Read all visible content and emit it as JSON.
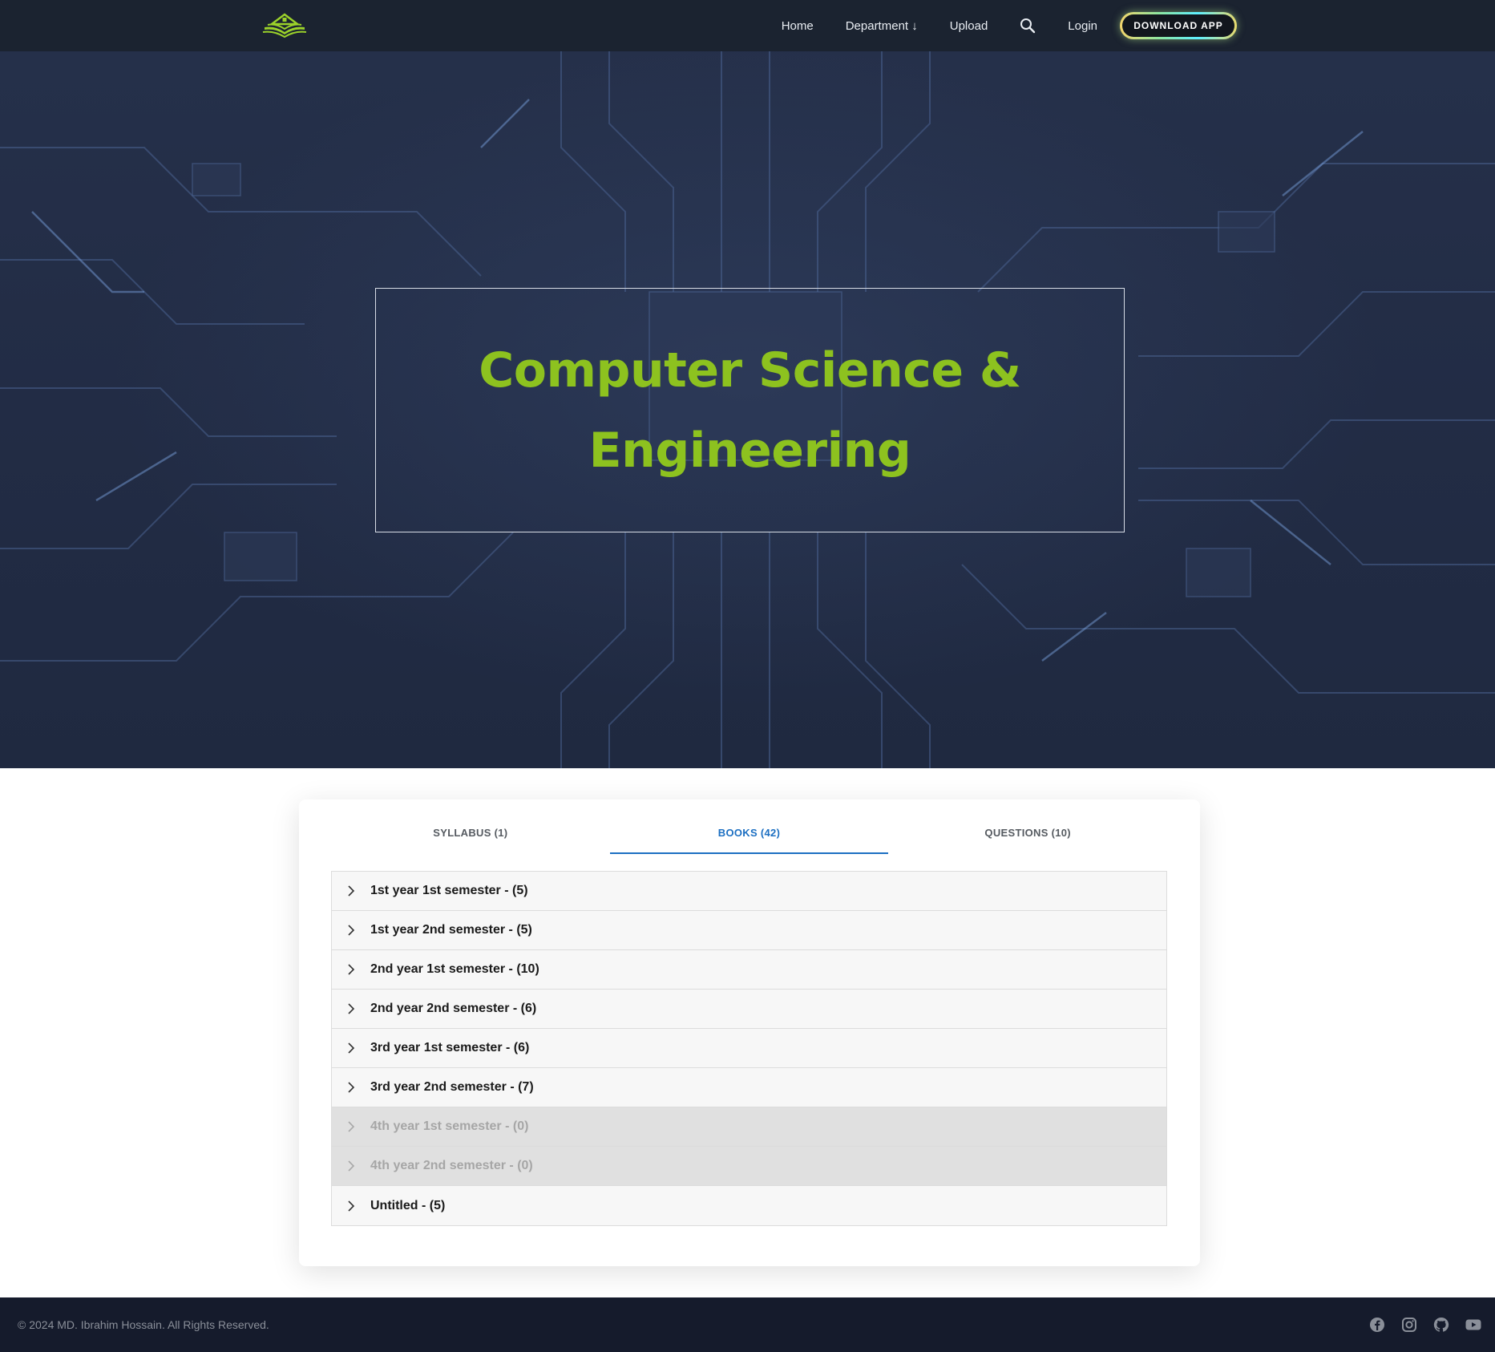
{
  "navbar": {
    "logo_icon": "book-house-logo-icon",
    "links": [
      "Home",
      "Department ↓",
      "Upload"
    ],
    "search_icon": "search-icon",
    "login": "Login",
    "download_app": "DOWNLOAD APP"
  },
  "hero": {
    "title": "Computer Science & Engineering",
    "title_color": "#8dc21f"
  },
  "tabs": [
    {
      "label": "SYLLABUS (1)",
      "active": false
    },
    {
      "label": "BOOKS (42)",
      "active": true
    },
    {
      "label": "QUESTIONS (10)",
      "active": false
    }
  ],
  "accordion": [
    {
      "label": "1st year 1st semester - (5)",
      "disabled": false
    },
    {
      "label": "1st year 2nd semester - (5)",
      "disabled": false
    },
    {
      "label": "2nd year 1st semester - (10)",
      "disabled": false
    },
    {
      "label": "2nd year 2nd semester - (6)",
      "disabled": false
    },
    {
      "label": "3rd year 1st semester - (6)",
      "disabled": false
    },
    {
      "label": "3rd year 2nd semester - (7)",
      "disabled": false
    },
    {
      "label": "4th year 1st semester - (0)",
      "disabled": true
    },
    {
      "label": "4th year 2nd semester - (0)",
      "disabled": true
    },
    {
      "label": "Untitled - (5)",
      "disabled": false
    }
  ],
  "footer": {
    "copyright": "© 2024 MD. Ibrahim Hossain. All Rights Reserved.",
    "socials": [
      "facebook-icon",
      "instagram-icon",
      "github-icon",
      "youtube-icon"
    ]
  },
  "colors": {
    "accent_blue": "#1c6fc2",
    "brand_green": "#8dc21f",
    "navbar_bg": "#1b2330",
    "footer_bg": "#151b2c"
  }
}
